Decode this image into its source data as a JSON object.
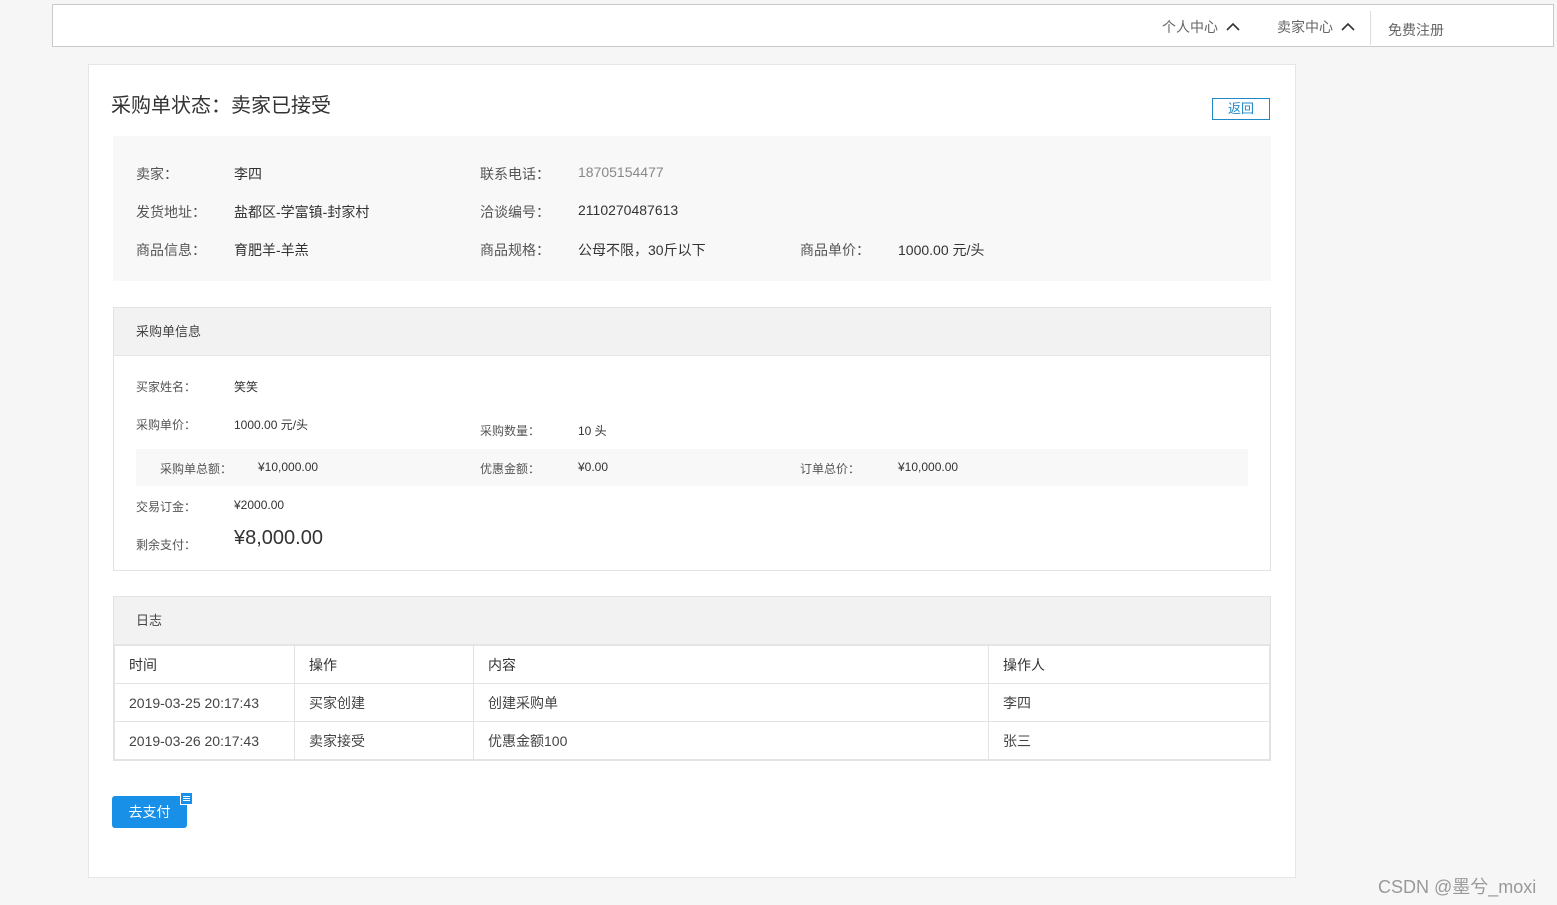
{
  "header": {
    "personal_center": "个人中心",
    "seller_center": "卖家中心",
    "register": "免费注册"
  },
  "page": {
    "title": "采购单状态：卖家已接受",
    "back_label": "返回"
  },
  "summary": {
    "seller_label": "卖家：",
    "seller_value": "李四",
    "phone_label": "联系电话：",
    "phone_value": "18705154477",
    "address_label": "发货地址：",
    "address_value": "盐都区-学富镇-封家村",
    "negotiation_label": "洽谈编号：",
    "negotiation_value": "2110270487613",
    "product_label": "商品信息：",
    "product_value": "育肥羊-羊羔",
    "spec_label": "商品规格：",
    "spec_value": "公母不限，30斤以下",
    "unit_price_label": "商品单价：",
    "unit_price_value": "1000.00 元/头"
  },
  "order_info": {
    "heading": "采购单信息",
    "buyer_name_label": "买家姓名：",
    "buyer_name_value": "笑笑",
    "purchase_price_label": "采购单价：",
    "purchase_price_value": "1000.00 元/头",
    "quantity_label": "采购数量：",
    "quantity_value": "10 头",
    "order_total_label": "采购单总额：",
    "order_total_value": "¥10,000.00",
    "discount_label": "优惠金额：",
    "discount_value": "¥0.00",
    "grand_total_label": "订单总价：",
    "grand_total_value": "¥10,000.00",
    "deposit_label": "交易订金：",
    "deposit_value": "¥2000.00",
    "remaining_label": "剩余支付：",
    "remaining_value": "¥8,000.00"
  },
  "log": {
    "heading": "日志",
    "columns": [
      "时间",
      "操作",
      "内容",
      "操作人"
    ],
    "rows": [
      [
        "2019-03-25 20:17:43",
        "买家创建",
        "创建采购单",
        "李四"
      ],
      [
        "2019-03-26 20:17:43",
        "卖家接受",
        "优惠金额100",
        "张三"
      ]
    ]
  },
  "actions": {
    "pay_label": "去支付"
  },
  "watermark": "CSDN @墨兮_moxi",
  "colors": {
    "accent": "#1890e8",
    "back_border": "#1e88c8"
  },
  "icons": {
    "chevron": "chevron-up-icon",
    "badge": "list-icon"
  }
}
